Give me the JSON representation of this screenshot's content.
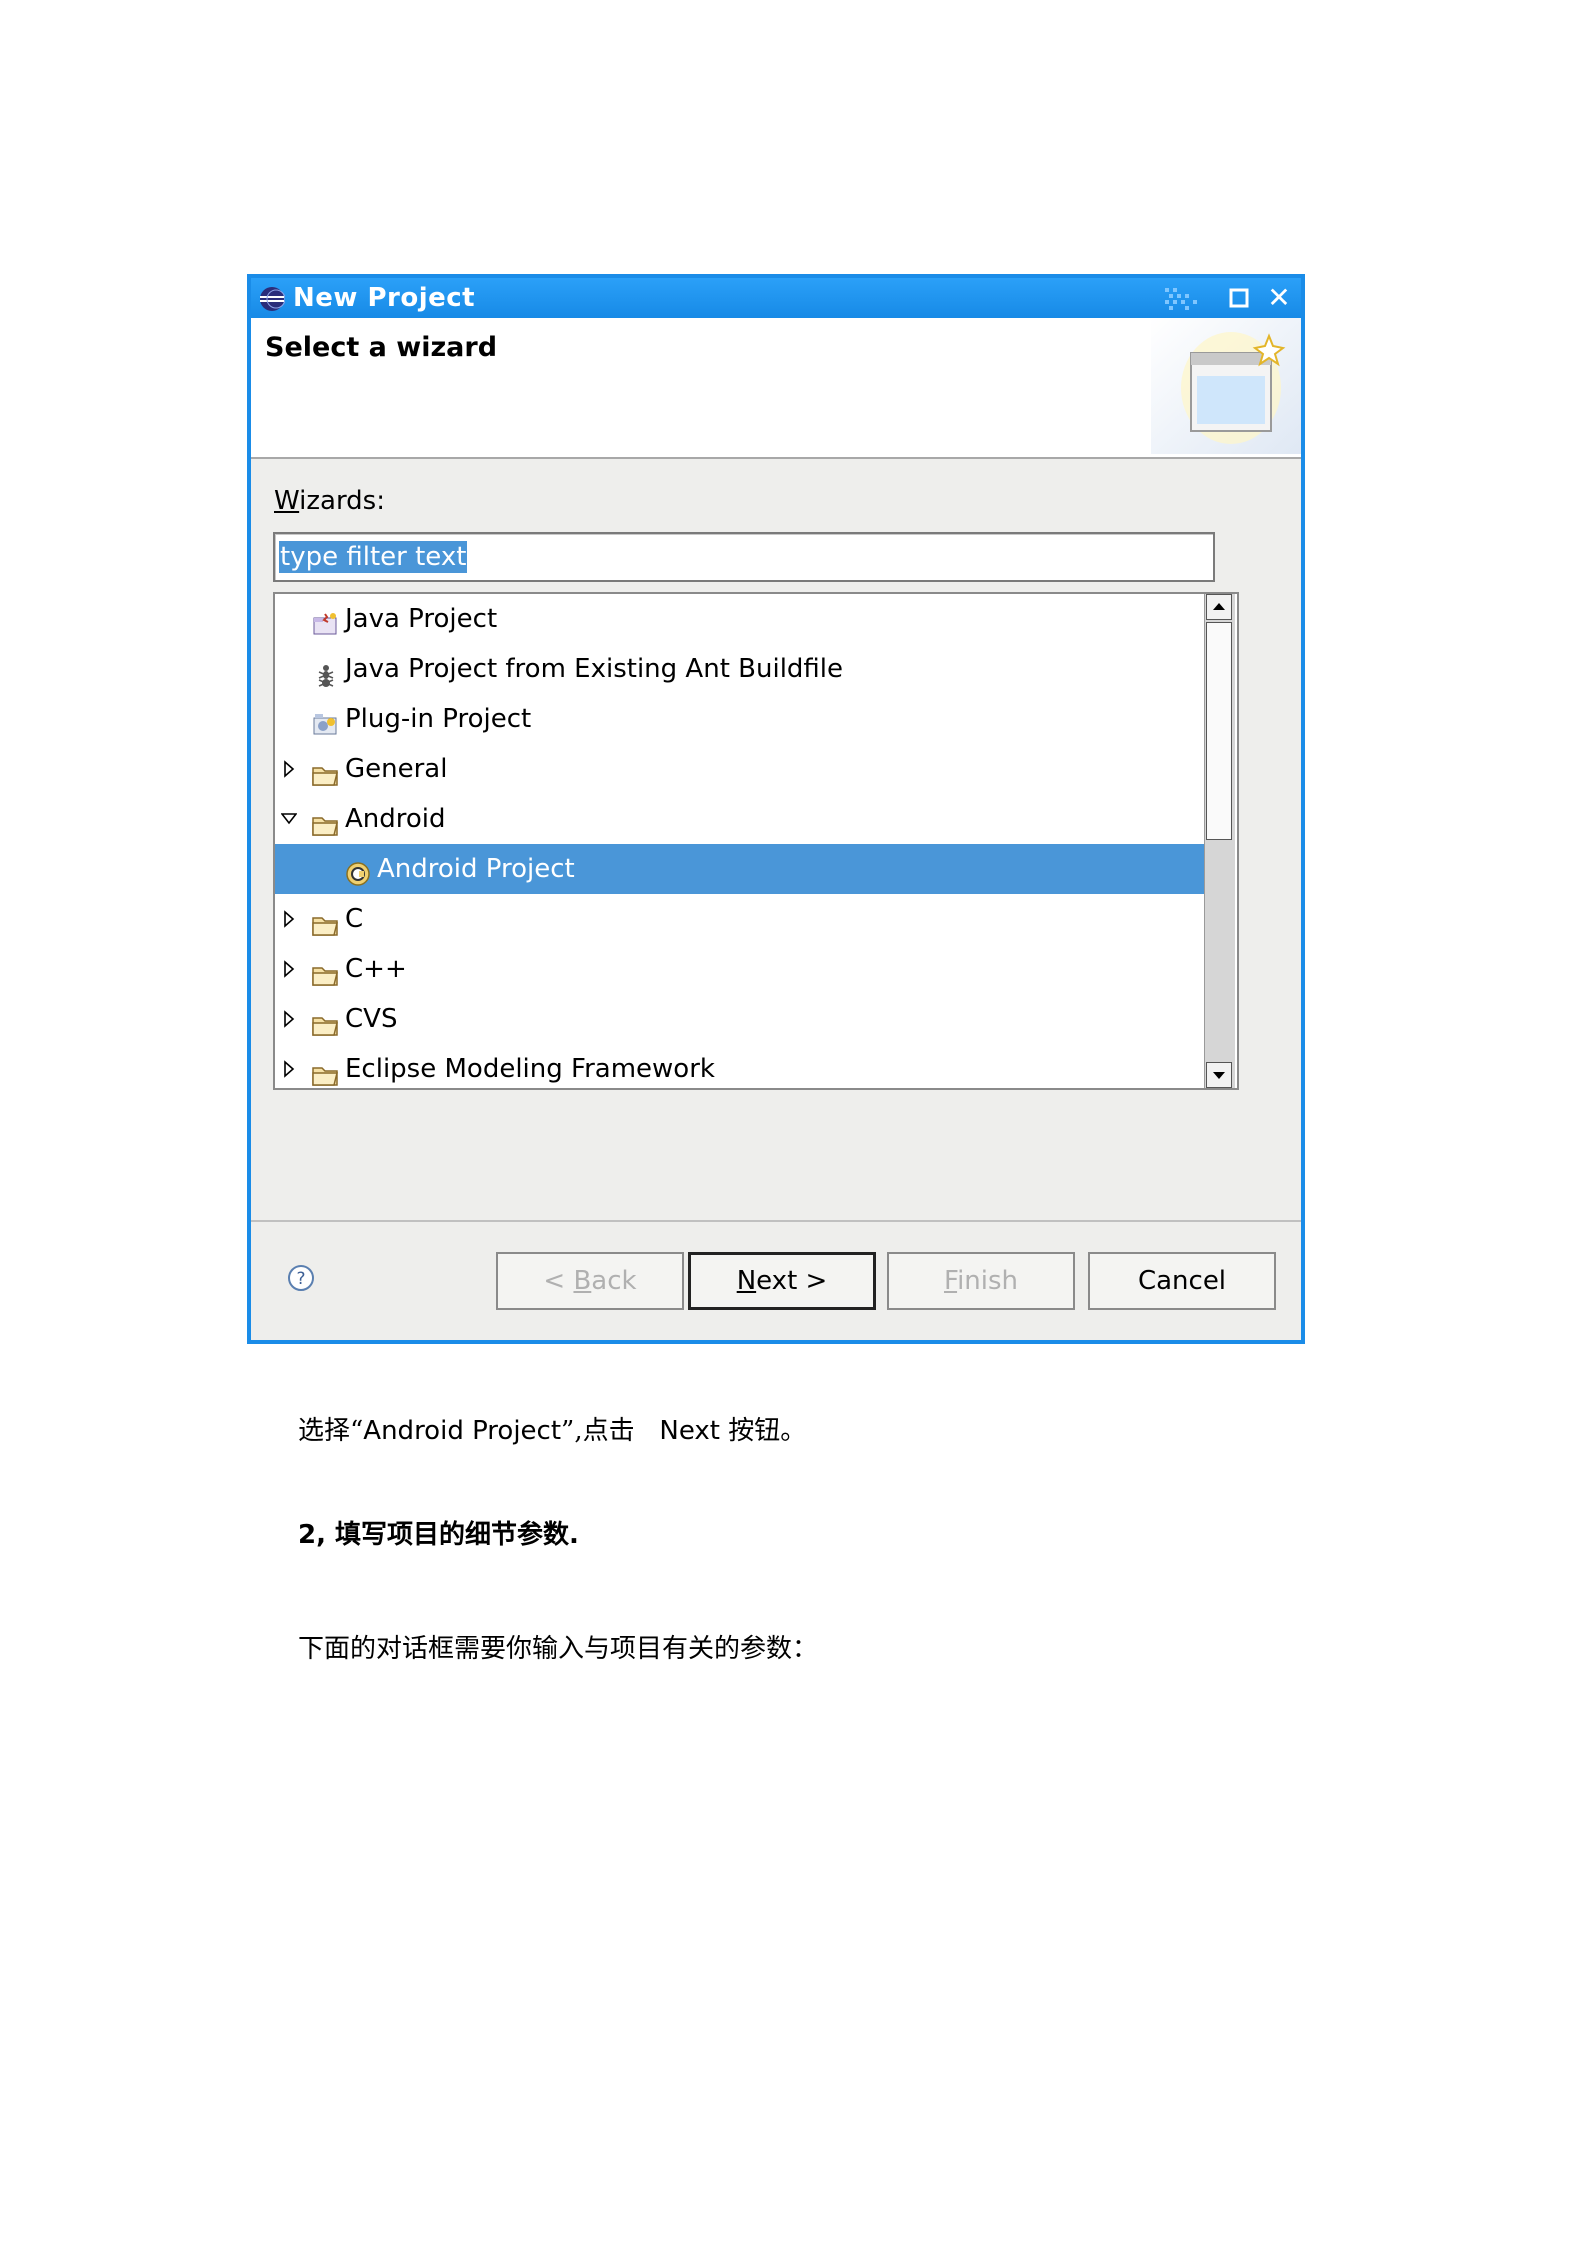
{
  "dialog": {
    "title": "New Project",
    "heading": "Select a wizard",
    "wizards_label_mnemonic": "W",
    "wizards_label_rest": "izards:",
    "filter_text": "type filter text",
    "tree": [
      {
        "label": "Java Project",
        "icon": "java-project-icon",
        "expander": "none",
        "level": 0
      },
      {
        "label": "Java Project from Existing Ant Buildfile",
        "icon": "ant-icon",
        "expander": "none",
        "level": 0
      },
      {
        "label": "Plug-in Project",
        "icon": "plugin-project-icon",
        "expander": "none",
        "level": 0
      },
      {
        "label": "General",
        "icon": "folder-icon",
        "expander": "collapsed",
        "level": 0
      },
      {
        "label": "Android",
        "icon": "folder-icon",
        "expander": "expanded",
        "level": 0
      },
      {
        "label": "Android Project",
        "icon": "android-project-icon",
        "expander": "none",
        "level": 1,
        "selected": true
      },
      {
        "label": "C",
        "icon": "folder-icon",
        "expander": "collapsed",
        "level": 0
      },
      {
        "label": "C++",
        "icon": "folder-icon",
        "expander": "collapsed",
        "level": 0
      },
      {
        "label": "CVS",
        "icon": "folder-icon",
        "expander": "collapsed",
        "level": 0
      },
      {
        "label": "Eclipse Modeling Framework",
        "icon": "folder-icon",
        "expander": "collapsed",
        "level": 0
      }
    ],
    "buttons": {
      "back_prefix": "< ",
      "back_mnemonic": "B",
      "back_rest": "ack",
      "next_mnemonic": "N",
      "next_rest": "ext >",
      "finish_mnemonic": "F",
      "finish_rest": "inish",
      "cancel": "Cancel"
    },
    "colors": {
      "titlebar": "#1a8ce8",
      "selection": "#4a96d8"
    }
  },
  "document": {
    "line1_cjk_a": "选择“",
    "line1_latin_a": "Android Project",
    "line1_cjk_b": "”,点击",
    "line1_latin_b": "Next",
    "line1_cjk_c": "按钮。",
    "heading": "2,  填写项目的细节参数.",
    "line3": "下面的对话框需要你输入与项目有关的参数："
  }
}
